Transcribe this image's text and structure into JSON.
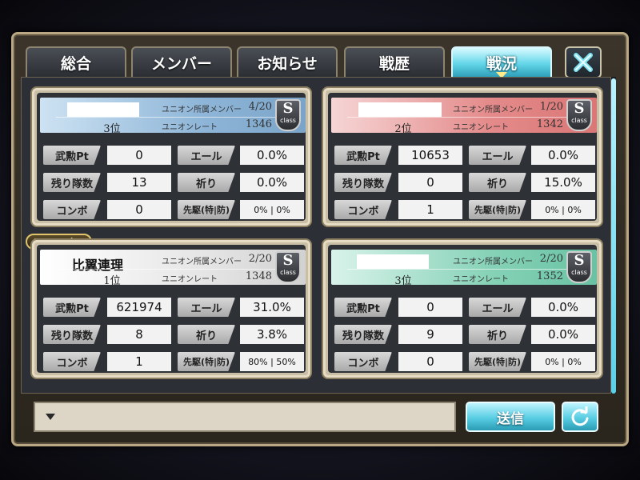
{
  "tabs": [
    {
      "label": "総合",
      "active": false
    },
    {
      "label": "メンバー",
      "active": false
    },
    {
      "label": "お知らせ",
      "active": false
    },
    {
      "label": "戦歴",
      "active": false
    },
    {
      "label": "戦況",
      "active": true
    }
  ],
  "header_labels": {
    "members": "ユニオン所属メンバー",
    "rate": "ユニオンレート",
    "class_letter": "S",
    "class_word": "class"
  },
  "stat_labels": {
    "pt": "武勲Pt",
    "remaining": "残り隊数",
    "combo": "コンボ",
    "cheer": "エール",
    "prayer": "祈り",
    "vanguard": "先駆(特|防)"
  },
  "my_union_badge": "MYユニオン",
  "unions": [
    {
      "name": "",
      "rank": "3位",
      "members": "4/20",
      "rate": "1346",
      "pt": "0",
      "remaining": "13",
      "combo": "0",
      "cheer": "0.0%",
      "prayer": "0.0%",
      "vanguard": "0% | 0%",
      "header_color": "#8fb6d8"
    },
    {
      "name": "",
      "rank": "2位",
      "members": "1/20",
      "rate": "1342",
      "pt": "10653",
      "remaining": "0",
      "combo": "1",
      "cheer": "0.0%",
      "prayer": "15.0%",
      "vanguard": "0% | 0%",
      "header_color": "#e48a8a"
    },
    {
      "name": "比翼連理",
      "rank": "1位",
      "members": "2/20",
      "rate": "1348",
      "pt": "621974",
      "remaining": "8",
      "combo": "1",
      "cheer": "31.0%",
      "prayer": "3.8%",
      "vanguard": "80% | 50%",
      "header_color": "#e6e6e6"
    },
    {
      "name": "",
      "rank": "3位",
      "members": "2/20",
      "rate": "1352",
      "pt": "0",
      "remaining": "9",
      "combo": "0",
      "cheer": "0.0%",
      "prayer": "0.0%",
      "vanguard": "0% | 0%",
      "header_color": "#86d2b7"
    }
  ],
  "chat": {
    "send_label": "送信"
  },
  "icons": {
    "close": "close-x-icon",
    "refresh": "refresh-icon",
    "dropdown": "triangle-down-icon"
  },
  "colors": {
    "accent": "#57cde2",
    "frame": "#b9a883"
  }
}
